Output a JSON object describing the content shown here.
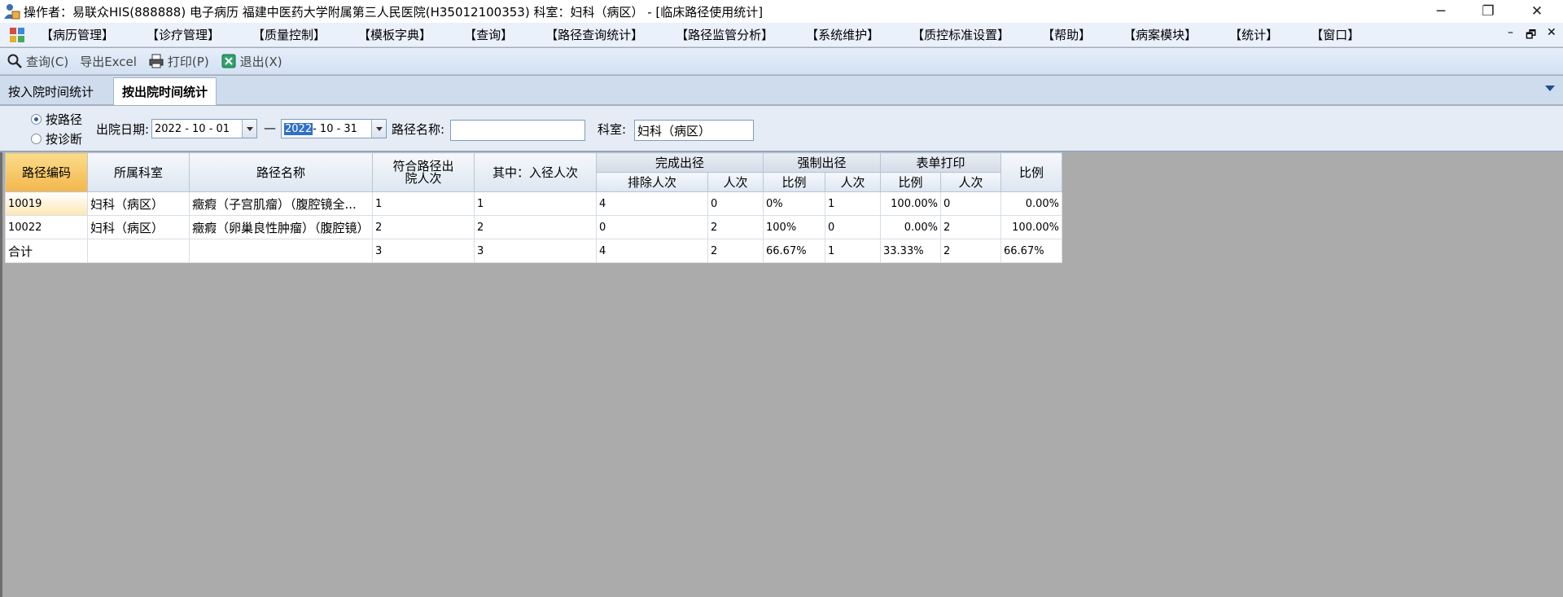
{
  "window": {
    "title": "操作者：易联众HIS(888888) 电子病历  福建中医药大学附属第三人民医院(H35012100353)  科室：妇科（病区）  - [临床路径使用统计]",
    "minimize": "─",
    "maximize": "❐",
    "close": "✕"
  },
  "menu": {
    "items": [
      "【病历管理】",
      "【诊疗管理】",
      "【质量控制】",
      "【模板字典】",
      "【查询】",
      "【路径查询统计】",
      "【路径监管分析】",
      "【系统维护】",
      "【质控标准设置】",
      "【帮助】",
      "【病案模块】",
      "【统计】",
      "【窗口】"
    ],
    "mdi_min": "–",
    "mdi_restore": "🗗",
    "mdi_close": "✕"
  },
  "toolbar": {
    "query": "查询(C)",
    "export": "导出Excel",
    "print": "打印(P)",
    "exit": "退出(X)"
  },
  "tabs": [
    "按入院时间统计",
    "按出院时间统计"
  ],
  "filter": {
    "radio_path": "按路径",
    "radio_diag": "按诊断",
    "date_label": "出院日期:",
    "date_from": "2022 - 10 - 01",
    "dash": "—",
    "date_to_year": "2022",
    "date_to_rest": " - 10 - 31",
    "path_name_label": "路径名称:",
    "path_name_value": "",
    "dept_label": "科室:",
    "dept_value": "妇科（病区）"
  },
  "grid": {
    "headers": {
      "code": "路径编码",
      "dept": "所属科室",
      "name": "路径名称",
      "eligible_line1": "符合路径出",
      "eligible_line2": "院人次",
      "entered": "其中：入径人次",
      "complete": "完成出径",
      "complete_excl": "排除人次",
      "complete_count": "人次",
      "forced": "强制出径",
      "forced_ratio": "比例",
      "forced_count": "人次",
      "form": "表单打印",
      "form_ratio": "比例",
      "form_count": "人次",
      "ratio": "比例"
    },
    "rows": [
      {
        "code": "10019",
        "dept": "妇科（病区）",
        "name": "癥瘕（子宫肌瘤）（腹腔镜全...",
        "eligible": "1",
        "entered": "1",
        "excl": "4",
        "complete": "0",
        "forced_ratio": "0%",
        "forced": "1",
        "form_ratio": "100.00%",
        "form": "0",
        "ratio": "0.00%"
      },
      {
        "code": "10022",
        "dept": "妇科（病区）",
        "name": "癥瘕（卵巢良性肿瘤）（腹腔镜）",
        "eligible": "2",
        "entered": "2",
        "excl": "0",
        "complete": "2",
        "forced_ratio": "100%",
        "forced": "0",
        "form_ratio": "0.00%",
        "form": "2",
        "ratio": "100.00%"
      },
      {
        "code": "合计",
        "dept": "",
        "name": "",
        "eligible": "3",
        "entered": "3",
        "excl": "4",
        "complete": "2",
        "forced_ratio": "66.67%",
        "forced": "1",
        "form_ratio": "33.33%",
        "form": "2",
        "ratio": "66.67%"
      }
    ]
  }
}
